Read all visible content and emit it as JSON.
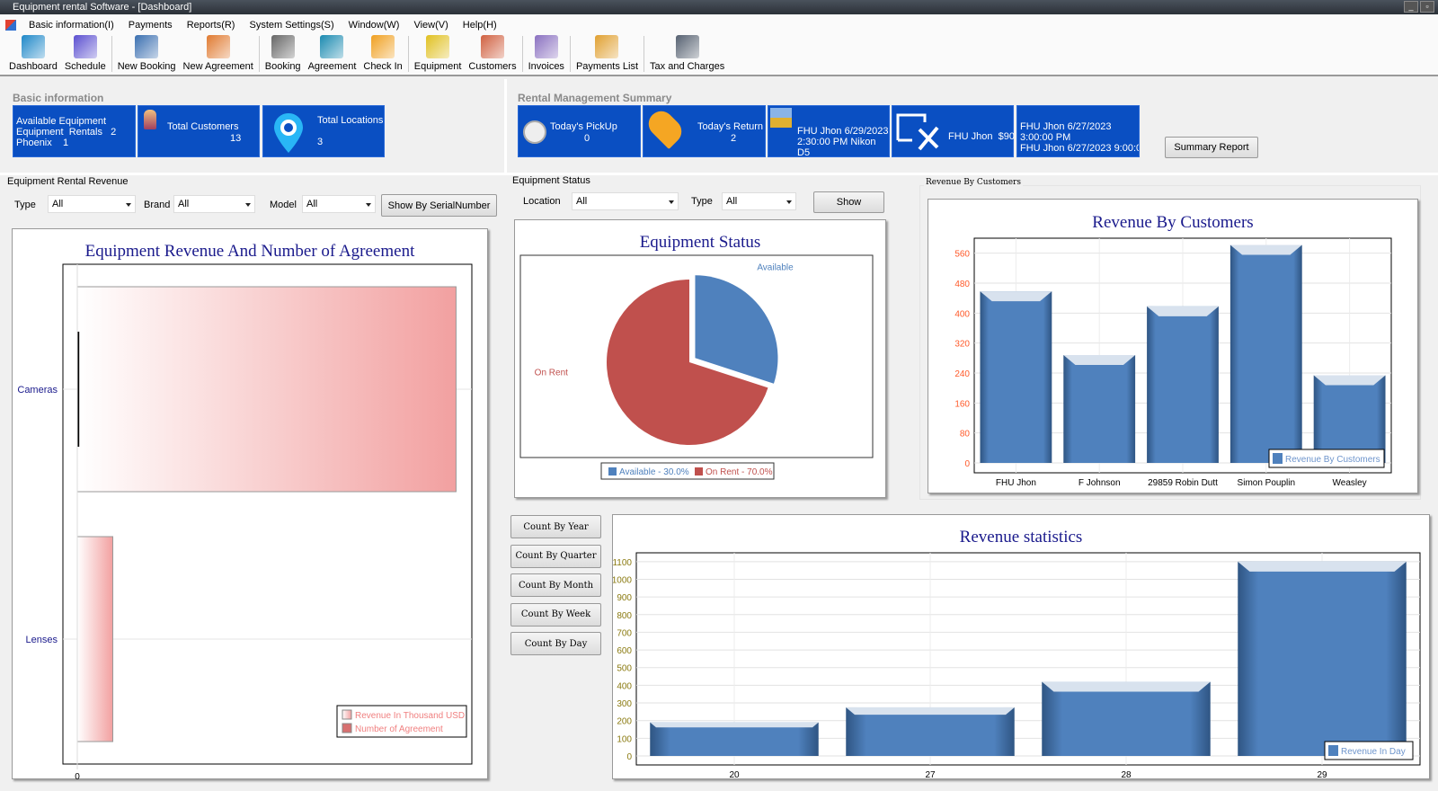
{
  "window": {
    "title": "Equipment rental Software - [Dashboard]"
  },
  "menu": [
    "Basic information(I)",
    "Payments",
    "Reports(R)",
    "System Settings(S)",
    "Window(W)",
    "View(V)",
    "Help(H)"
  ],
  "toolbar": [
    {
      "label": "Dashboard",
      "icon": "dashboard-icon",
      "color": "#1e88c8"
    },
    {
      "label": "Schedule",
      "icon": "schedule-icon",
      "color": "#5b4fd0"
    },
    {
      "label": "New Booking",
      "icon": "new-booking-icon",
      "color": "#3a6fb0"
    },
    {
      "label": "New Agreement",
      "icon": "new-agreement-icon",
      "color": "#e07a30"
    },
    {
      "label": "Booking",
      "icon": "booking-icon",
      "color": "#666666"
    },
    {
      "label": "Agreement",
      "icon": "agreement-icon",
      "color": "#1a8ab0"
    },
    {
      "label": "Check In",
      "icon": "check-in-icon",
      "color": "#f0a020"
    },
    {
      "label": "Equipment",
      "icon": "equipment-icon",
      "color": "#e0c020"
    },
    {
      "label": "Customers",
      "icon": "customers-icon",
      "color": "#d06040"
    },
    {
      "label": "Invoices",
      "icon": "invoices-icon",
      "color": "#8a70c0"
    },
    {
      "label": "Payments List",
      "icon": "payments-list-icon",
      "color": "#e0a030"
    },
    {
      "label": "Tax and Charges",
      "icon": "calculator-icon",
      "color": "#556070"
    }
  ],
  "basic_info": {
    "label": "Basic information",
    "available": {
      "line1": "Available Equipment",
      "line2": "Equipment  Rentals   2",
      "line3": "Phoenix    1"
    },
    "customers": {
      "label": "Total Customers",
      "value": "13"
    },
    "locations": {
      "label": "Total Locations",
      "value": "3"
    }
  },
  "rental_summary": {
    "label": "Rental  Management  Summary",
    "pickup": {
      "label": "Today's PickUp",
      "value": "0"
    },
    "return": {
      "label": "Today's Return",
      "value": "2"
    },
    "payment": {
      "line1": "FHU Jhon 6/29/2023",
      "line2": "2:30:00 PM Nikon D5"
    },
    "checkin": {
      "text": "FHU Jhon  $90"
    },
    "booking": {
      "line1": "FHU Jhon 6/27/2023",
      "line2": "3:00:00 PM",
      "line3": "FHU Jhon 6/27/2023 9:00:0"
    },
    "summary_button": "Summary Report"
  },
  "equipment_revenue": {
    "group_label": "Equipment Rental Revenue",
    "filters": {
      "type_label": "Type",
      "type_value": "All",
      "brand_label": "Brand",
      "brand_value": "All",
      "model_label": "Model",
      "model_value": "All"
    },
    "button": "Show By SerialNumber"
  },
  "equipment_status": {
    "group_label": "Equipment  Status",
    "filters": {
      "location_label": "Location",
      "location_value": "All",
      "type_label": "Type",
      "type_value": "All"
    },
    "button": "Show"
  },
  "revenue_customers_group": "Revenue By Customers",
  "count_buttons": [
    "Count By Year",
    "Count By Quarter",
    "Count By Month",
    "Count By Week",
    "Count By Day"
  ],
  "chart_data": [
    {
      "type": "bar",
      "orientation": "horizontal",
      "title": "Equipment  Revenue And Number of Agreement",
      "categories": [
        "Cameras",
        "Lenses"
      ],
      "x_ticks": [
        "0"
      ],
      "value_units": "fraction of axis",
      "series": [
        {
          "name": "Revenue In Thousand USD",
          "values": [
            0.96,
            0.09
          ],
          "color": "#f2a0a0"
        },
        {
          "name": "Number of Agreement",
          "values": [
            0.005,
            0
          ],
          "color": "#d87070"
        }
      ],
      "legend": "bottom-right"
    },
    {
      "type": "pie",
      "title": "Equipment  Status",
      "slices": [
        {
          "label": "Available",
          "value": 30.0,
          "legend": "Available - 30.0%",
          "color": "#4f81bd"
        },
        {
          "label": "On Rent",
          "value": 70.0,
          "legend": "On Rent - 70.0%",
          "color": "#c0504d"
        }
      ],
      "legend": "bottom"
    },
    {
      "type": "bar",
      "title": "Revenue By Customers",
      "categories": [
        "FHU Jhon",
        "F Johnson",
        "29859 Robin Dutt",
        "Simon Pouplin",
        "Weasley"
      ],
      "series": [
        {
          "name": "Revenue By Customers",
          "values": [
            458,
            288,
            418,
            582,
            234
          ],
          "color": "#4f81bd"
        }
      ],
      "ylim": [
        0,
        600
      ],
      "yticks": [
        0,
        80,
        160,
        240,
        320,
        400,
        480,
        560
      ],
      "grid": true,
      "legend": "bottom-right"
    },
    {
      "type": "bar",
      "title": "Revenue statistics",
      "categories": [
        "20",
        "27",
        "28",
        "29"
      ],
      "series": [
        {
          "name": "Revenue In Day",
          "values": [
            190,
            275,
            420,
            1100
          ],
          "color": "#4f81bd"
        }
      ],
      "ylim": [
        0,
        1150
      ],
      "yticks": [
        0,
        100,
        200,
        300,
        400,
        500,
        600,
        700,
        800,
        900,
        1000,
        1100
      ],
      "grid": true,
      "legend": "bottom-right"
    }
  ]
}
